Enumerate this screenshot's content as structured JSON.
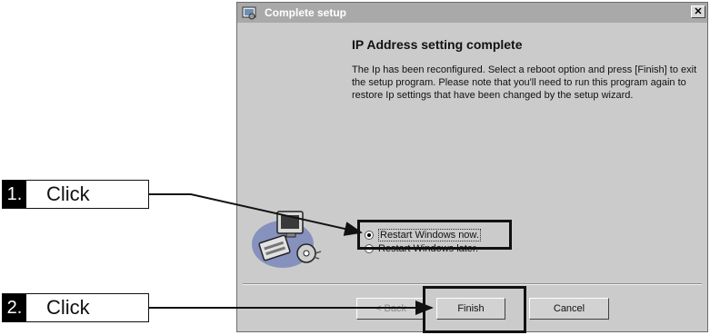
{
  "dialog": {
    "title": "Complete setup",
    "close_glyph": "✕",
    "heading": "IP Address setting complete",
    "body": "The Ip has been reconfigured. Select a reboot option and press [Finish] to exit the setup program. Please note that you'll need to run this program again to restore Ip settings that have been changed by the setup wizard.",
    "options": [
      {
        "label": "Restart Windows now.",
        "selected": true
      },
      {
        "label": "Restart Windows later.",
        "selected": false
      }
    ],
    "buttons": {
      "back": "< Back",
      "finish": "Finish",
      "cancel": "Cancel"
    },
    "title_icon": "setup-icon",
    "illustration": "computer-wizard-icon"
  },
  "callouts": [
    {
      "number": "1.",
      "text": "Click"
    },
    {
      "number": "2.",
      "text": "Click"
    }
  ],
  "colors": {
    "titlebar": "#a9a9a9",
    "dialog_bg": "#cbcbcb",
    "ink": "#111111"
  }
}
